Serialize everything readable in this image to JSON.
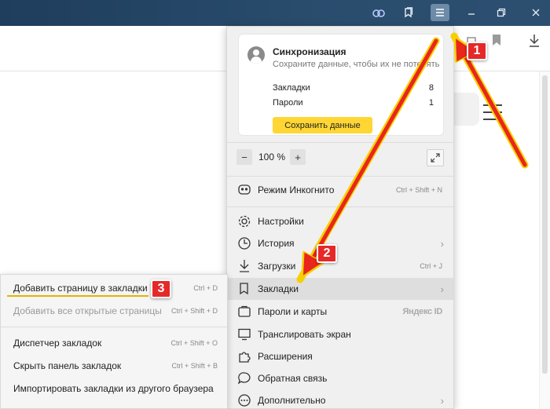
{
  "titlebar": {
    "icons": [
      "vpn-icon",
      "collections-icon",
      "menu-icon",
      "minimize-icon",
      "restore-icon"
    ]
  },
  "toolbar": {
    "icons": [
      "pocket-icon",
      "bookmark-icon",
      "download-icon"
    ]
  },
  "sync": {
    "title": "Синхронизация",
    "subtitle": "Сохраните данные, чтобы их не потерять",
    "rows": [
      {
        "label": "Закладки",
        "count": "8"
      },
      {
        "label": "Пароли",
        "count": "1"
      }
    ],
    "save_label": "Сохранить данные"
  },
  "zoom": {
    "minus": "−",
    "value": "100 %",
    "plus": "+"
  },
  "menu": {
    "incognito": {
      "label": "Режим Инкогнито",
      "shortcut": "Ctrl + Shift + N"
    },
    "settings": {
      "label": "Настройки"
    },
    "history": {
      "label": "История"
    },
    "downloads": {
      "label": "Загрузки",
      "shortcut": "Ctrl + J"
    },
    "bookmarks": {
      "label": "Закладки"
    },
    "passwords": {
      "label": "Пароли и карты",
      "brand": "Яндекс ID"
    },
    "cast": {
      "label": "Транслировать экран"
    },
    "extensions": {
      "label": "Расширения"
    },
    "feedback": {
      "label": "Обратная связь"
    },
    "more": {
      "label": "Дополнительно"
    }
  },
  "submenu": {
    "add_page": {
      "label": "Добавить страницу в закладки",
      "shortcut": "Ctrl + D"
    },
    "add_all": {
      "label": "Добавить все открытые страницы",
      "shortcut": "Ctrl + Shift + D"
    },
    "manager": {
      "label": "Диспетчер закладок",
      "shortcut": "Ctrl + Shift + O"
    },
    "hide_bar": {
      "label": "Скрыть панель закладок",
      "shortcut": "Ctrl + Shift + B"
    },
    "import": {
      "label": "Импортировать закладки из другого браузера"
    }
  },
  "annotations": {
    "badge1": "1",
    "badge2": "2",
    "badge3": "3"
  },
  "colors": {
    "titlebar": "#1f3d5c",
    "accent_yellow": "#ffd633",
    "badge_red": "#e52929",
    "arrow_red": "#e8261c",
    "arrow_outline": "#f5d000"
  }
}
